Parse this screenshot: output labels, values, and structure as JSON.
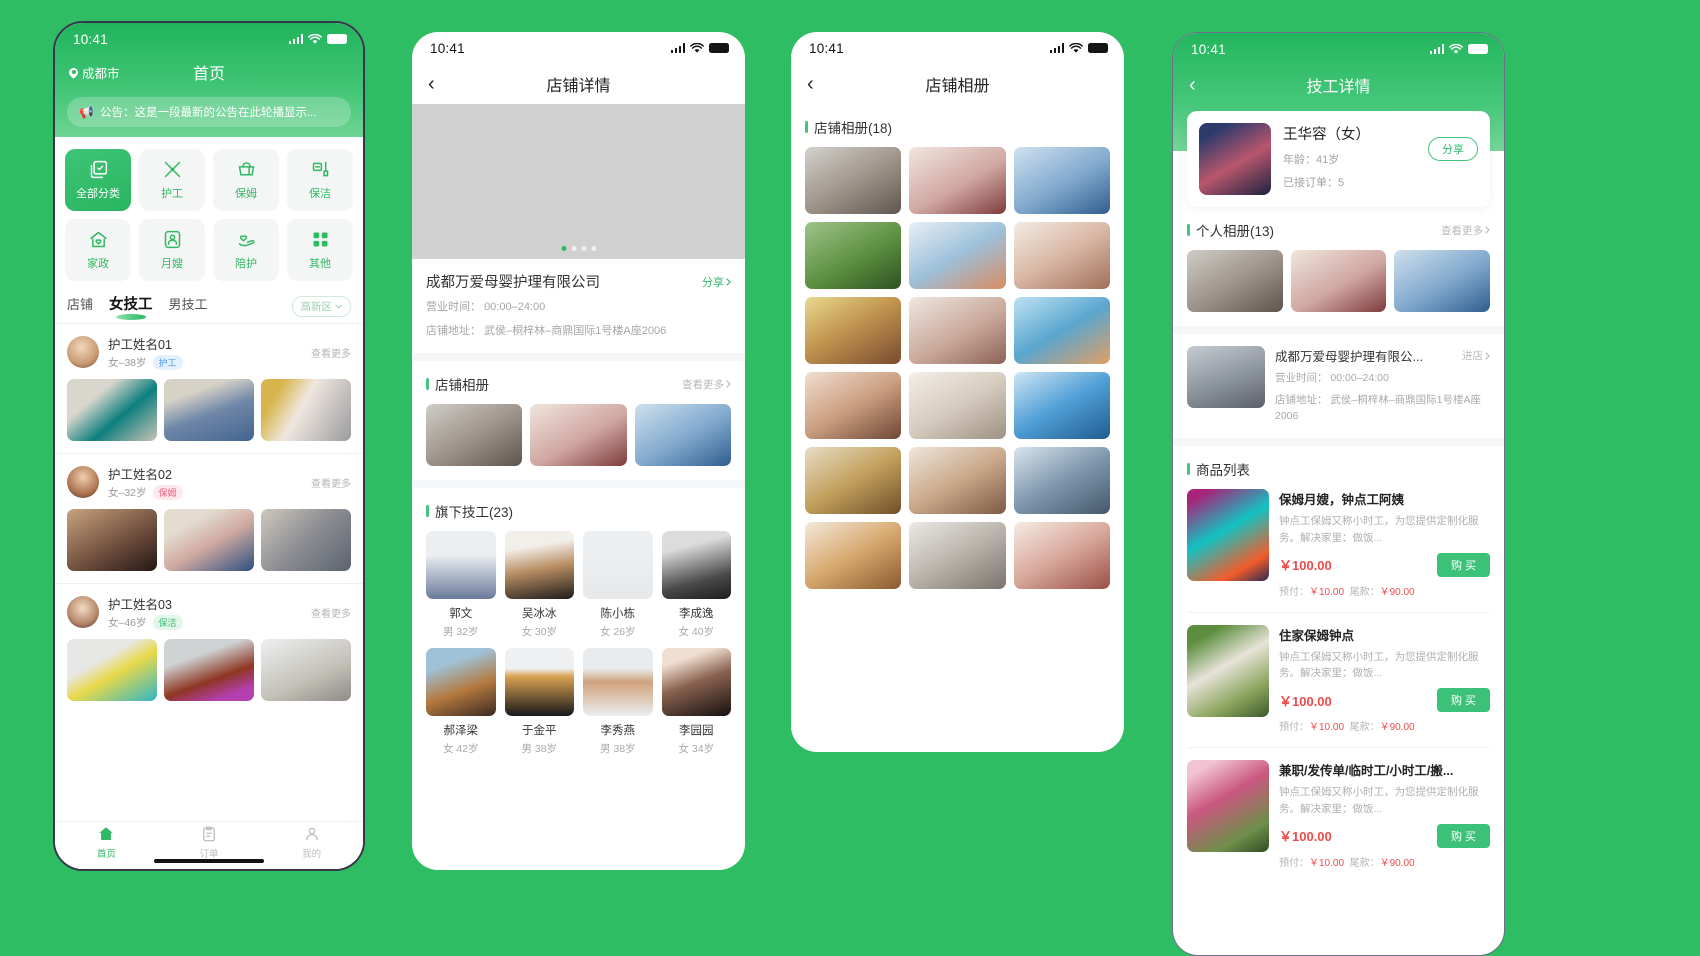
{
  "status_bar": {
    "time": "10:41"
  },
  "phone1": {
    "city": "成都市",
    "title": "首页",
    "notice": "公告：这是一段最新的公告在此轮播显示...",
    "categories": [
      {
        "label": "全部分类",
        "icon": "all-categories-icon",
        "active": true
      },
      {
        "label": "护工",
        "icon": "tools-icon",
        "active": false
      },
      {
        "label": "保姆",
        "icon": "basket-icon",
        "active": false
      },
      {
        "label": "保洁",
        "icon": "mop-icon",
        "active": false
      },
      {
        "label": "家政",
        "icon": "house-heart-icon",
        "active": false
      },
      {
        "label": "月嫂",
        "icon": "nanny-icon",
        "active": false
      },
      {
        "label": "陪护",
        "icon": "care-hand-icon",
        "active": false
      },
      {
        "label": "其他",
        "icon": "grid-icon",
        "active": false
      }
    ],
    "tabs": [
      {
        "label": "店铺",
        "active": false
      },
      {
        "label": "女技工",
        "active": true
      },
      {
        "label": "男技工",
        "active": false
      }
    ],
    "district": "高新区",
    "more_label": "查看更多",
    "workers": [
      {
        "name": "护工姓名01",
        "sub": "女–38岁",
        "tag": "护工",
        "tag_style": "blue"
      },
      {
        "name": "护工姓名02",
        "sub": "女–32岁",
        "tag": "保姆",
        "tag_style": "pink"
      },
      {
        "name": "护工姓名03",
        "sub": "女–46岁",
        "tag": "保洁",
        "tag_style": "green"
      }
    ],
    "tabbar": [
      {
        "label": "首页",
        "icon": "home-icon",
        "active": true
      },
      {
        "label": "订单",
        "icon": "order-icon",
        "active": false
      },
      {
        "label": "我的",
        "icon": "user-icon",
        "active": false
      }
    ]
  },
  "phone2": {
    "title": "店铺详情",
    "back_icon": "chevron-left-icon",
    "carousel_dots": 4,
    "carousel_active": 0,
    "shop_name": "成都万爱母婴护理有限公司",
    "share_label": "分享",
    "hours_label": "营业时间：",
    "hours_value": "00:00–24:00",
    "address_label": "店铺地址：",
    "address_value": "武侯–桐梓林–商鼎国际1号楼A座2006",
    "album_title": "店铺相册",
    "album_more": "查看更多",
    "tech_title": "旗下技工(23)",
    "technicians": [
      {
        "name": "郭文",
        "meta": "男 32岁"
      },
      {
        "name": "吴冰冰",
        "meta": "女 30岁"
      },
      {
        "name": "陈小栋",
        "meta": "女 26岁"
      },
      {
        "name": "李成逸",
        "meta": "女 40岁"
      },
      {
        "name": "郝泽梁",
        "meta": "女 42岁"
      },
      {
        "name": "于金平",
        "meta": "男 38岁"
      },
      {
        "name": "李秀燕",
        "meta": "男 38岁"
      },
      {
        "name": "李园园",
        "meta": "女 34岁"
      }
    ]
  },
  "phone3": {
    "title": "店铺相册",
    "back_icon": "chevron-left-icon",
    "section_title": "店铺相册(18)",
    "photo_count": 18
  },
  "phone4": {
    "title": "技工详情",
    "back_icon": "chevron-left-icon",
    "worker_name": "王华容（女）",
    "age_line": "年龄：41岁",
    "orders_line": "已接订单：5",
    "share_label": "分享",
    "album_title": "个人相册(13)",
    "album_more": "查看更多",
    "shop_name": "成都万爱母婴护理有限公...",
    "enter_label": "进店",
    "hours_label": "营业时间：",
    "hours_value": "00:00–24:00",
    "address_label": "店铺地址：",
    "address_value": "武侯–桐梓林–商鼎国际1号楼A座2006",
    "products_title": "商品列表",
    "products": [
      {
        "title": "保姆月嫂，钟点工阿姨",
        "desc": "钟点工保姆又称小时工，为您提供定制化服务。解决家里：做饭...",
        "price": "￥100.00",
        "buy_label": "购 买",
        "prepay_label": "预付：",
        "prepay_value": "￥10.00",
        "balance_label": "尾款：",
        "balance_value": "￥90.00"
      },
      {
        "title": "住家保姆钟点",
        "desc": "钟点工保姆又称小时工，为您提供定制化服务。解决家里：做饭...",
        "price": "￥100.00",
        "buy_label": "购 买",
        "prepay_label": "预付：",
        "prepay_value": "￥10.00",
        "balance_label": "尾款：",
        "balance_value": "￥90.00"
      },
      {
        "title": "兼职/发传单/临时工/小时工/搬...",
        "desc": "钟点工保姆又称小时工，为您提供定制化服务。解决家里：做饭...",
        "price": "￥100.00",
        "buy_label": "购 买",
        "prepay_label": "预付：",
        "prepay_value": "￥10.00",
        "balance_label": "尾款：",
        "balance_value": "￥90.00"
      }
    ]
  },
  "colors": {
    "brand_green": "#2fbd63",
    "accent_green": "#3cc178",
    "price_red": "#f04b4b",
    "page_bg": "#f5f6f7"
  }
}
